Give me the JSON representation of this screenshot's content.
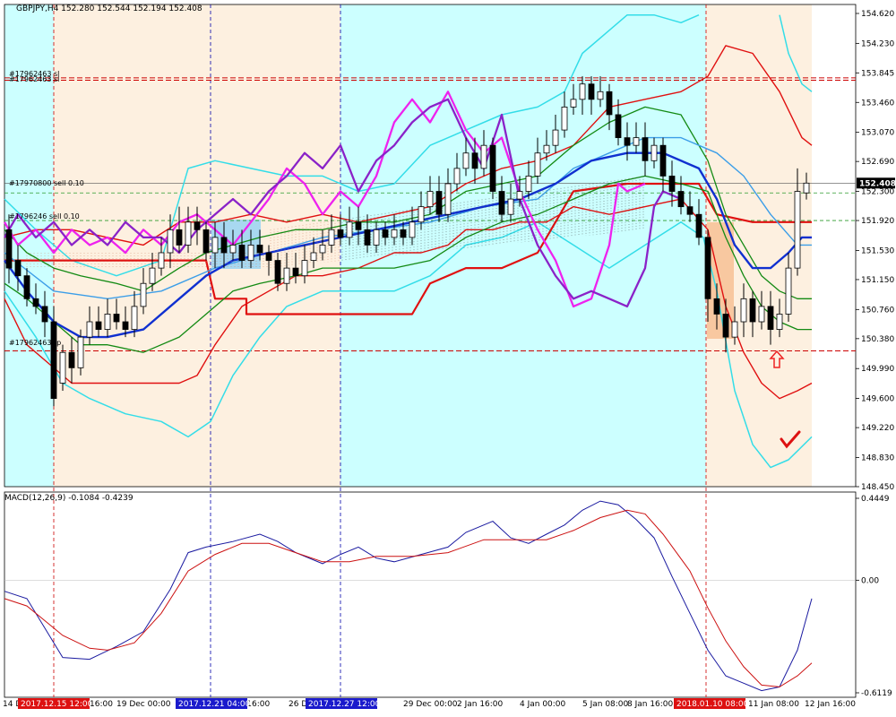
{
  "header": {
    "symbol_line": "GBPJPY,H4  152.280 152.544 152.194 152.408",
    "macd_line": "MACD(12,26,9) -0.1084 -0.4239"
  },
  "price_axis": {
    "ticks": [
      "154.620",
      "154.230",
      "153.845",
      "153.460",
      "153.070",
      "152.690",
      "152.300",
      "151.920",
      "151.530",
      "151.150",
      "150.760",
      "150.380",
      "149.990",
      "149.600",
      "149.220",
      "148.830",
      "148.450"
    ],
    "current": "152.408"
  },
  "macd_axis": {
    "ticks": [
      "0.4449",
      "0.00",
      "-0.6119"
    ]
  },
  "time_axis": {
    "labels": [
      "14 D",
      "19 Dec 00:00",
      "Dec 16:00",
      "26 D",
      "29 Dec 00:00",
      "2 Jan 16:00",
      "4 Jan 00:00",
      "5 Jan 08:00",
      "8 Jan 16:00",
      "11 Jan 08:00",
      "12 Jan 16:00"
    ],
    "markers": [
      "2017.12.15 12:00",
      "2017.12.21 04:00",
      "2017.12.27 12:00",
      "2018.01.10 08:00"
    ],
    "marker_after": [
      "16:00"
    ]
  },
  "order_labels": {
    "top_red": "#17962463 sl",
    "top_red2": "#17962463 sl",
    "sell_main": "#17970800 sell 0.10",
    "sell_2": "#1796246 sell 0.10",
    "bottom_red": "#17962463 tp"
  },
  "colors": {
    "bg_cyan": "#ccffff",
    "bg_peach": "#fdf0e0",
    "bb_outer": "#33dde8",
    "red_band": "#e01010",
    "green_line": "#138a13",
    "blue_line": "#1030d0",
    "light_blue": "#3c9ee8",
    "magenta": "#ee22ee",
    "purple": "#8a22c8"
  },
  "chart_data": {
    "type": "line",
    "symbol": "GBPJPY",
    "timeframe": "H4",
    "ohlc_current": {
      "open": 152.28,
      "high": 152.544,
      "low": 152.194,
      "close": 152.408
    },
    "ylim": [
      148.45,
      154.62
    ],
    "macd": {
      "fast": 12,
      "slow": 26,
      "signal": 9,
      "main": -0.1084,
      "signal_value": -0.4239,
      "ylim": [
        -0.6119,
        0.4449
      ]
    },
    "levels": {
      "sl": 153.78,
      "sell_entry": 152.28,
      "sell_2": 151.92,
      "tp": 150.22
    }
  }
}
